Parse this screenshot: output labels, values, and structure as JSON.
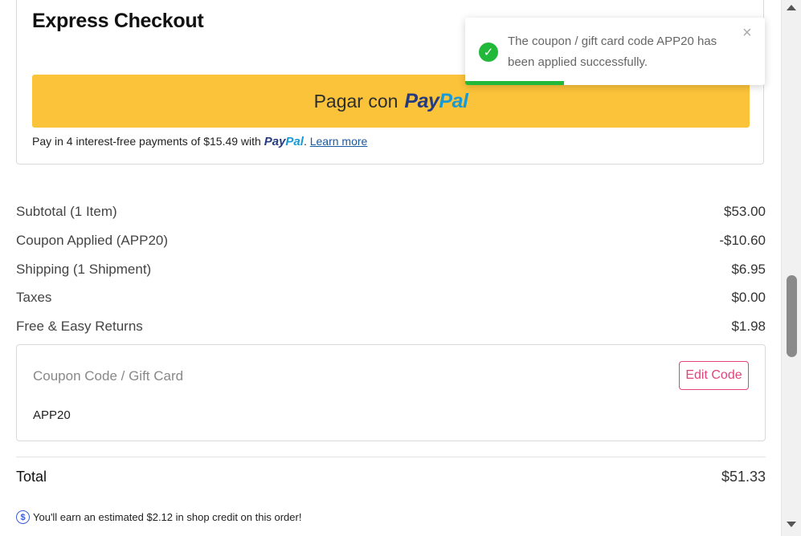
{
  "express": {
    "title": "Express Checkout",
    "paypal_button": {
      "prefix": "Pagar con",
      "logo_pay": "Pay",
      "logo_pal": "Pal"
    },
    "installments": {
      "text": "Pay in 4 interest-free payments of $15.49 with",
      "logo_pay": "Pay",
      "logo_pal": "Pal",
      "link": "Learn more"
    }
  },
  "summary": {
    "rows": [
      {
        "label": "Subtotal (1 Item)",
        "value": "$53.00"
      },
      {
        "label": "Coupon Applied (APP20)",
        "value": "-$10.60"
      },
      {
        "label": "Shipping (1 Shipment)",
        "value": "$6.95"
      },
      {
        "label": "Taxes",
        "value": "$0.00"
      },
      {
        "label": "Free & Easy Returns",
        "value": "$1.98"
      }
    ]
  },
  "coupon": {
    "label": "Coupon Code / Gift Card",
    "code": "APP20",
    "edit_label": "Edit Code"
  },
  "total": {
    "label": "Total",
    "value": "$51.33"
  },
  "credit": {
    "icon": "$",
    "text": "You'll earn an estimated $2.12 in shop credit on this order!"
  },
  "toast": {
    "message": "The coupon / gift card code APP20 has been applied successfully.",
    "close": "×",
    "check": "✓",
    "progress": 0.33
  },
  "colors": {
    "paypal_yellow": "#fbc33a",
    "paypal_dark": "#253b80",
    "paypal_light": "#179bd7",
    "accent_pink": "#e2437b",
    "success_green": "#22b83a"
  }
}
